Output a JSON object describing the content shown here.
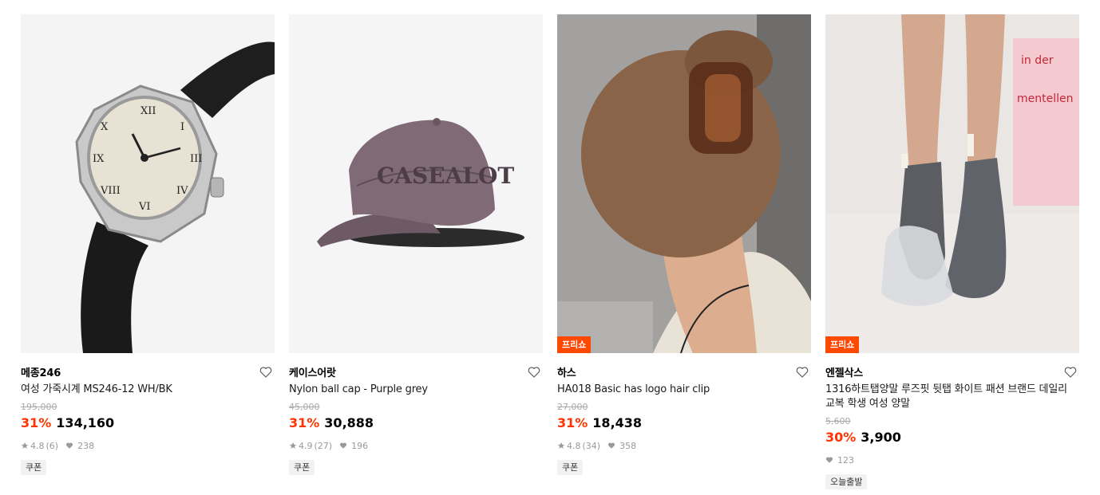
{
  "products": [
    {
      "brand": "메종246",
      "name": "여성 가죽시계 MS246-12 WH/BK",
      "original_price": "195,000",
      "discount": "31%",
      "price": "134,160",
      "rating": "4.8",
      "review_count": "(6)",
      "likes": "238",
      "tag": "쿠폰",
      "badge": null
    },
    {
      "brand": "케이스어랏",
      "name": "Nylon ball cap - Purple grey",
      "original_price": "45,000",
      "discount": "31%",
      "price": "30,888",
      "rating": "4.9",
      "review_count": "(27)",
      "likes": "196",
      "tag": "쿠폰",
      "badge": null
    },
    {
      "brand": "하스",
      "name": "HA018 Basic has logo hair clip",
      "original_price": "27,000",
      "discount": "31%",
      "price": "18,438",
      "rating": "4.8",
      "review_count": "(34)",
      "likes": "358",
      "tag": "쿠폰",
      "badge": "프리쇼"
    },
    {
      "brand": "엔젤삭스",
      "name": "1316하트탭양말 루즈핏 뒷탭 화이트 패션 브랜드 데일리 교복 학생 여성 양말",
      "original_price": "5,600",
      "discount": "30%",
      "price": "3,900",
      "likes": "123",
      "tag": "오늘출발",
      "badge": "프리쇼"
    }
  ],
  "icons": {
    "like": "heart-outline-icon",
    "rating": "star-icon",
    "likes": "heart-filled-icon"
  },
  "colors": {
    "discount": "#ff3300",
    "badge": "#ff4800",
    "muted": "#9a9a9a"
  }
}
